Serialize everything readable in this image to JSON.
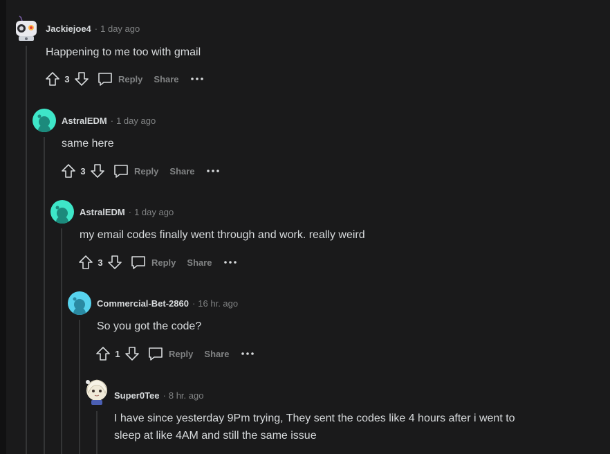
{
  "comments": [
    {
      "author": "Jackiejoe4",
      "time": "1 day ago",
      "text": "Happening to me too with gmail",
      "score": "3",
      "reply_label": "Reply",
      "share_label": "Share"
    },
    {
      "author": "AstralEDM",
      "time": "1 day ago",
      "text": "same here",
      "score": "3",
      "reply_label": "Reply",
      "share_label": "Share"
    },
    {
      "author": "AstralEDM",
      "time": "1 day ago",
      "text": "my email codes finally went through and work. really weird",
      "score": "3",
      "reply_label": "Reply",
      "share_label": "Share"
    },
    {
      "author": "Commercial-Bet-2860",
      "time": "16 hr. ago",
      "text": "So you got the code?",
      "score": "1",
      "reply_label": "Reply",
      "share_label": "Share"
    },
    {
      "author": "Super0Tee",
      "time": "8 hr. ago",
      "text_line1": "I have since yesterday 9Pm trying, They sent the codes like 4 hours after i went to",
      "text_line2": "sleep at like 4AM and still the same issue"
    }
  ],
  "separator": "·",
  "icons": {
    "upvote": "arrow-up-outline-icon",
    "downvote": "arrow-down-outline-icon",
    "reply": "speech-bubble-icon",
    "more": "ellipsis-icon",
    "default_avatar": "snoo-icon"
  },
  "colors": {
    "background": "#1a1a1b",
    "text": "#d7dadc",
    "muted": "#818384",
    "thread_line": "#343536",
    "avatar_teal": "#3ee6c8",
    "avatar_blue": "#57d3ee"
  }
}
